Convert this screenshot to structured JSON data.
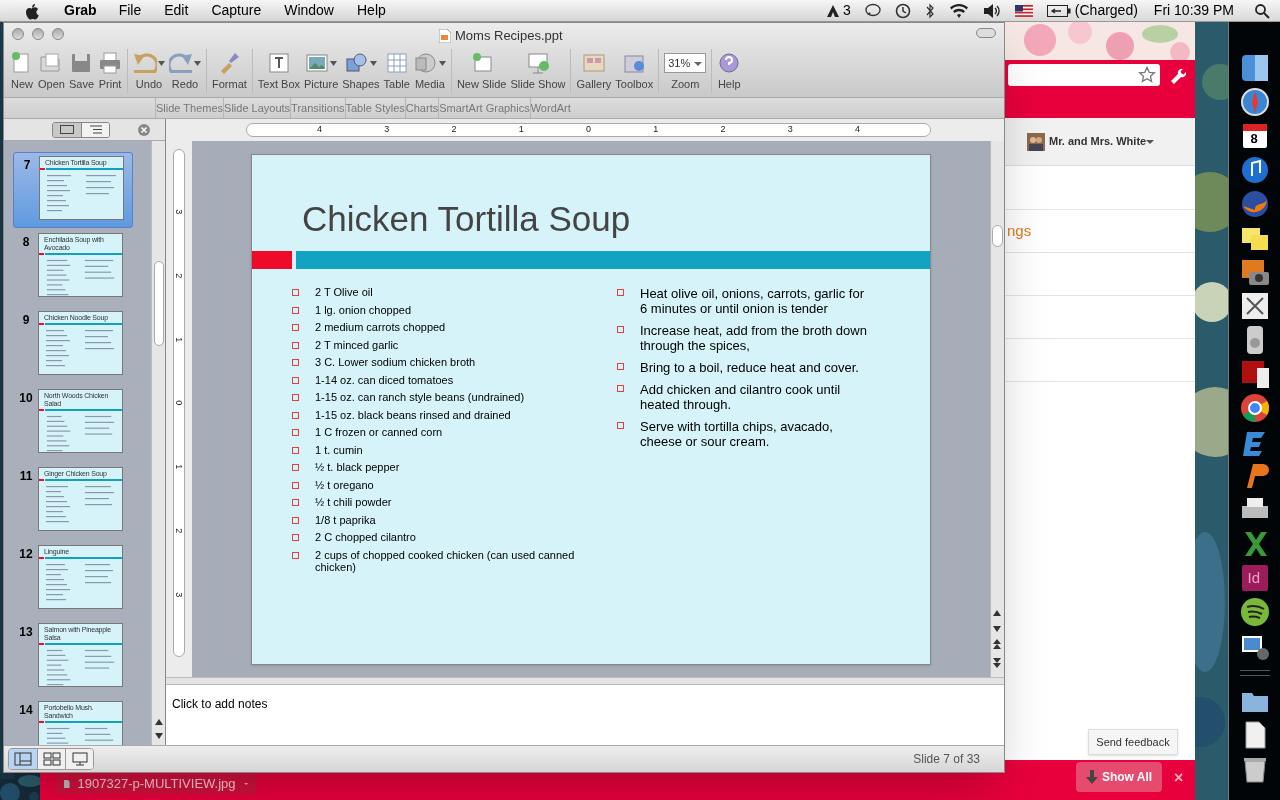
{
  "menu_bar": {
    "app": "Grab",
    "menus": [
      "File",
      "Edit",
      "Capture",
      "Window",
      "Help"
    ],
    "adobe_count": "3",
    "battery": "(Charged)",
    "clock": "Fri 10:39 PM"
  },
  "ppt_window": {
    "title": "Moms Recipes.ppt",
    "toolbar": [
      {
        "kind": "new",
        "label": "New"
      },
      {
        "kind": "open",
        "label": "Open"
      },
      {
        "kind": "save",
        "label": "Save"
      },
      {
        "kind": "print",
        "label": "Print"
      },
      {
        "kind": "sep"
      },
      {
        "kind": "undo",
        "label": "Undo",
        "caret": true
      },
      {
        "kind": "redo",
        "label": "Redo",
        "caret": true
      },
      {
        "kind": "sep"
      },
      {
        "kind": "format",
        "label": "Format"
      },
      {
        "kind": "sep"
      },
      {
        "kind": "textbox",
        "label": "Text Box"
      },
      {
        "kind": "picture",
        "label": "Picture",
        "caret": true
      },
      {
        "kind": "shapes",
        "label": "Shapes",
        "caret": true
      },
      {
        "kind": "table",
        "label": "Table"
      },
      {
        "kind": "media",
        "label": "Media",
        "caret": true
      },
      {
        "kind": "sep"
      },
      {
        "kind": "newslide",
        "label": "New Slide"
      },
      {
        "kind": "slideshow",
        "label": "Slide Show"
      },
      {
        "kind": "sep"
      },
      {
        "kind": "gallery",
        "label": "Gallery"
      },
      {
        "kind": "toolbox",
        "label": "Toolbox"
      },
      {
        "kind": "sep"
      },
      {
        "kind": "zoom",
        "label": "Zoom",
        "value": "31%"
      },
      {
        "kind": "sep"
      },
      {
        "kind": "help",
        "label": "Help"
      }
    ],
    "ribbon_tabs": [
      "Slide Themes",
      "Slide Layouts",
      "Transitions",
      "Table Styles",
      "Charts",
      "SmartArt Graphics",
      "WordArt"
    ],
    "thumbnails": [
      {
        "number": "7",
        "title": "Chicken Tortilla Soup",
        "selected": true
      },
      {
        "number": "8",
        "title": "Enchilada Soup with Avocado",
        "selected": false
      },
      {
        "number": "9",
        "title": "Chicken Noodle Soup",
        "selected": false
      },
      {
        "number": "10",
        "title": "North Woods Chicken Salad",
        "selected": false
      },
      {
        "number": "11",
        "title": "Ginger Chicken Soup",
        "selected": false
      },
      {
        "number": "12",
        "title": "Linguine",
        "selected": false
      },
      {
        "number": "13",
        "title": "Salmon with Pineapple Salsa",
        "selected": false
      },
      {
        "number": "14",
        "title": "Portobello Mush. Sandwich",
        "selected": false
      }
    ],
    "ruler_labels": [
      "4",
      "3",
      "2",
      "1",
      "0",
      "1",
      "2",
      "3",
      "4"
    ],
    "vertical_ruler_labels": [
      "3",
      "2",
      "1",
      "0",
      "1",
      "2",
      "3"
    ],
    "slide": {
      "title": "Chicken Tortilla Soup",
      "ingredients": [
        "2 T Olive oil",
        "1 lg. onion chopped",
        "2 medium carrots chopped",
        "2 T minced garlic",
        "3 C. Lower sodium chicken broth",
        "1-14 oz. can diced tomatoes",
        "1-15 oz. can ranch style beans (undrained)",
        "1-15 oz. black beans rinsed and drained",
        "1 C frozen or canned corn",
        "1 t. cumin",
        "½ t. black pepper",
        "½ t oregano",
        "½ t chili powder",
        "1/8 t paprika",
        "2 C chopped cilantro",
        "2 cups of chopped cooked chicken (can used canned chicken)"
      ],
      "steps": [
        "Heat olive oil, onions, carrots, garlic for 6 minutes or until onion is tender",
        "Increase heat, add from the broth down through the spices,",
        "Bring to a boil, reduce heat and cover.",
        "Add chicken and cilantro cook until heated through.",
        "Serve with tortilla chips, avacado, cheese or sour cream."
      ]
    },
    "notes_placeholder": "Click to add notes",
    "status": "Slide 7 of 33",
    "view_buttons": [
      {
        "kind": "normal",
        "selected": true
      },
      {
        "kind": "sorter",
        "selected": false
      },
      {
        "kind": "show",
        "selected": false
      }
    ]
  },
  "browser": {
    "profile_name": "Mr. and Mrs. White",
    "partial_link": "ngs",
    "feedback": "Send feedback",
    "download_file": "1907327-p-MULTIVIEW.jpg",
    "show_all": "Show All",
    "close": "×"
  },
  "dock": [
    {
      "kind": "finder"
    },
    {
      "kind": "compass"
    },
    {
      "kind": "calendar",
      "label": "8"
    },
    {
      "kind": "music"
    },
    {
      "kind": "globe"
    },
    {
      "kind": "notes"
    },
    {
      "kind": "camera"
    },
    {
      "kind": "scissors"
    },
    {
      "kind": "player"
    },
    {
      "kind": "curtain"
    },
    {
      "kind": "chrome"
    },
    {
      "kind": "letter_e"
    },
    {
      "kind": "letter_p"
    },
    {
      "kind": "scanner"
    },
    {
      "kind": "letter_x"
    },
    {
      "kind": "letter",
      "label": "Id"
    },
    {
      "kind": "waves"
    },
    {
      "kind": "photos"
    },
    {
      "kind": "sep"
    },
    {
      "kind": "folder"
    },
    {
      "kind": "file"
    },
    {
      "kind": "trash"
    }
  ]
}
